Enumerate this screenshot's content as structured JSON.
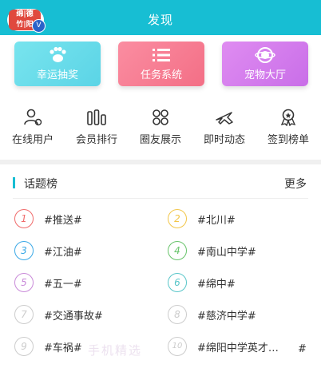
{
  "header": {
    "title": "发现",
    "avatar_text": "绵竹\n德阳",
    "verified": "V"
  },
  "cards": [
    {
      "label": "幸运抽奖",
      "icon": "paw-icon"
    },
    {
      "label": "任务系统",
      "icon": "list-icon"
    },
    {
      "label": "宠物大厅",
      "icon": "planet-icon"
    }
  ],
  "nav": [
    {
      "label": "在线用户",
      "icon": "user-online-icon"
    },
    {
      "label": "会员排行",
      "icon": "ranking-bars-icon"
    },
    {
      "label": "圈友展示",
      "icon": "grid-circles-icon"
    },
    {
      "label": "即时动态",
      "icon": "airplane-icon"
    },
    {
      "label": "签到榜单",
      "icon": "medal-icon"
    }
  ],
  "topics": {
    "title": "话题榜",
    "more": "更多",
    "items": [
      {
        "num": "1",
        "text": "#推送#",
        "color": "#f06b6b"
      },
      {
        "num": "2",
        "text": "#北川#",
        "color": "#f2c649"
      },
      {
        "num": "3",
        "text": "#江油#",
        "color": "#3aa8e6"
      },
      {
        "num": "4",
        "text": "#南山中学#",
        "color": "#67c36a"
      },
      {
        "num": "5",
        "text": "#五一#",
        "color": "#c98ad9"
      },
      {
        "num": "6",
        "text": "#绵中#",
        "color": "#58c6c9"
      },
      {
        "num": "7",
        "text": "#交通事故#",
        "color": "#c8c8c8"
      },
      {
        "num": "8",
        "text": "#慈济中学#",
        "color": "#c8c8c8"
      },
      {
        "num": "9",
        "text": "#车祸#",
        "color": "#c8c8c8"
      },
      {
        "num": "10",
        "text": "#绵阳中学英才…",
        "color": "#c8c8c8"
      }
    ],
    "extra_hash": "#"
  },
  "watermark": "手机精选"
}
